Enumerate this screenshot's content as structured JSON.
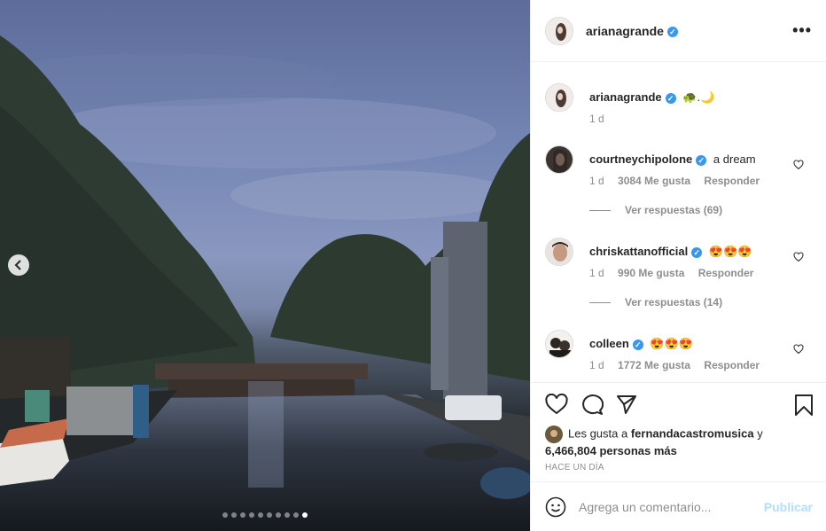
{
  "post": {
    "author": "arianagrande",
    "more_label": "•••"
  },
  "caption": {
    "author": "arianagrande",
    "text": "🐢.🌙",
    "time": "1 d"
  },
  "comments": [
    {
      "author": "courtneychipolone",
      "text": "a dream",
      "time": "1 d",
      "likes": "3084 Me gusta",
      "reply_label": "Responder",
      "view_replies": "Ver respuestas (69)"
    },
    {
      "author": "chriskattanofficial",
      "text": "😍😍😍",
      "time": "1 d",
      "likes": "990 Me gusta",
      "reply_label": "Responder",
      "view_replies": "Ver respuestas (14)"
    },
    {
      "author": "colleen",
      "text": "😍😍😍",
      "time": "1 d",
      "likes": "1772 Me gusta",
      "reply_label": "Responder"
    }
  ],
  "likes_summary": {
    "prefix": "Les gusta a",
    "user": "fernandacastromusica",
    "joiner": "y",
    "count": "6,466,804 personas más"
  },
  "time_ago": "HACE UN DÍA",
  "comment_input": {
    "placeholder": "Agrega un comentario...",
    "publish_label": "Publicar"
  },
  "carousel": {
    "total_slides": 10,
    "active_index": 9
  },
  "colors": {
    "verified": "#3897f0",
    "publish_disabled": "#b2dffc",
    "muted_text": "#8e8e8e"
  }
}
